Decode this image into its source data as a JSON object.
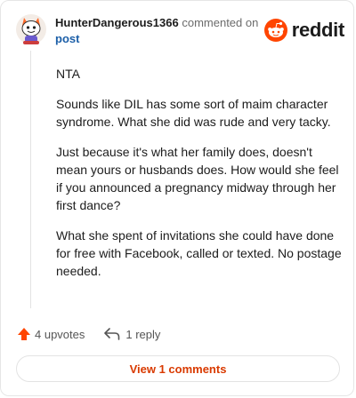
{
  "header": {
    "username": "HunterDangerous1366",
    "action_text": "commented on",
    "post_link": "post",
    "brand_name": "reddit",
    "brand_color": "#ff4500"
  },
  "comment": {
    "paragraphs": [
      "NTA",
      "Sounds like DIL has some sort of maim character syndrome. What she did was rude and very tacky.",
      "Just because it's what her family does, doesn't mean yours or husbands does. How would she feel if you announced a pregnancy midway through her first dance?",
      "What she spent of invitations she could have done for free with Facebook, called or texted. No postage needed."
    ]
  },
  "actions": {
    "upvotes_label": "4 upvotes",
    "reply_label": "1 reply"
  },
  "footer": {
    "view_comments_label": "View 1 comments",
    "accent_color": "#d93a00"
  },
  "icons": [
    "avatar",
    "reddit-logo-icon",
    "upvote-arrow-icon",
    "reply-arrow-icon"
  ]
}
